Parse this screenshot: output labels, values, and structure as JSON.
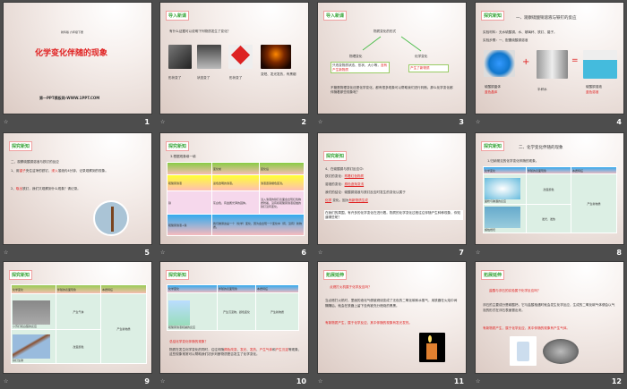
{
  "slides": [
    {
      "number": "1",
      "subtitle": "新科版  六年级下册",
      "title": "化学变化伴随的现象",
      "footer": "第一PPT模板网-WWW.1PPT.COM"
    },
    {
      "number": "2",
      "tag": "导入新课",
      "question": "有什么证据可以说明下列物质发生了变化？",
      "captions": [
        "形状变了",
        "状态变了",
        "形状变了",
        "变短、发光发热，有黑烟"
      ]
    },
    {
      "number": "3",
      "tag": "导入新课",
      "center": "物质变化的形式",
      "left": "物理变化",
      "right": "化学变化",
      "left_box": "只改变物质状态、形状、大小等，",
      "left_box_red": "没有产生新物质",
      "right_box": "产生了新物质",
      "body": "不管是物理变化还是化学变化，都有很多现象可以帮助我们进行判断。那么化学变化都伴随着那些现象呢？"
    },
    {
      "number": "4",
      "tag": "探究新知",
      "heading": "一、观察硫酸铜溶液与铁钉的反应",
      "materials": "实验材料：无水硫酸铜、水、玻璃杯、铁钉、镊子。",
      "steps": "实验步骤：一、配置硫酸铜溶液",
      "captions": [
        [
          "硫酸铜晶体",
          "蓝色晶体"
        ],
        [
          "半杯水",
          ""
        ],
        [
          "硫酸铜溶液",
          "蓝色溶液"
        ]
      ],
      "plus": "+",
      "equals": "="
    },
    {
      "number": "5",
      "tag": "探究新知",
      "line1": "二、观察硫酸铜溶液与铁钉的反应",
      "line2a": "1、用",
      "line2r": "镊子",
      "line2b": "夹住洁净的铁钉，",
      "line2r2": "浸入",
      "line2c": "溶液约4分钟，记录观察到的现象。",
      "line3a": "2、",
      "line3r": "取出",
      "line3b": "铁钉，我们又观察到什么现象？请记录。"
    },
    {
      "number": "6",
      "tag": "探究新知",
      "title": "3.根据现象填一填",
      "headers": [
        "",
        "变化前",
        "变化后"
      ],
      "rows": [
        [
          "硫酸铜溶液",
          "蓝色透明的溶液。",
          "溶液逐渐褪色变浅。"
        ],
        [
          "铁",
          "灰白色，有金属光泽的固体。",
          "浸入溶液的铁钉表面会出现红色物质附着，没有和硫酸铜溶液接触的铁钉没有变化。"
        ],
        [
          "硫酸铜溶液+铁",
          "我们推测这是一个（化学）变化，因为会出现一个变化中（有、没有）新物质。",
          ""
        ]
      ]
    },
    {
      "number": "7",
      "tag": "探究新知",
      "intro": "4、在硫酸铜与铁钉反应中：",
      "l1": "铁钉的变化：",
      "l1r": "附着红色物质",
      "l2": "溶液的变化：",
      "l2r": "颜色逐渐变浅",
      "l3": "我们的结论：硫酸铜溶液与铁钉反应时发生的变化认属于",
      "l4r": "化学",
      "l4": "变化。因为",
      "l4r2": "有新物质生成",
      "box": "在我们的周围，有许多的化学变化在进行着。物质的化学变化过程往往伴随产生种种现象，你知道哪些呢？"
    },
    {
      "number": "8",
      "tag": "探究新知",
      "heading": "二、化学变化伴随的现象",
      "sub": "1.归纳常见的化学变化伴随的现象。",
      "headers": [
        "化学变化",
        "伴随的表面现象",
        "本质特征"
      ],
      "rows": [
        [
          "面粉与碘酒的反应",
          "改变颜色"
        ],
        [
          "蜡烛燃烧",
          "发光、发热"
        ]
      ],
      "essence": "产生新物质"
    },
    {
      "number": "9",
      "tag": "探究新知",
      "headers": [
        "化学变化",
        "伴随的表面现象",
        "本质特征"
      ],
      "rows": [
        [
          "小苏打和白醋的反应",
          "产生气体"
        ],
        [
          "铁钉生锈",
          "改变颜色"
        ]
      ],
      "essence": "产生新物质"
    },
    {
      "number": "10",
      "tag": "探究新知",
      "headers": [
        "化学变化",
        "伴随的表面现象",
        "本质特征"
      ],
      "row": [
        "硫酸铜溶液和碱的反应",
        "产生沉淀物，颜色变化",
        "产生新物质"
      ],
      "question": "总结化学变化伴随的现象？",
      "body_a": "物质在发生化学变化的同时，往往伴随",
      "r1": "颜色改变",
      "s1": "、",
      "r2": "发光",
      "s2": "、",
      "r3": "发热",
      "s3": "、",
      "r4": "产生气体",
      "s4": "和",
      "r5": "产生沉淀",
      "body_b": "等现象，这些现象常常可以帮助我们初步判断物质是否发生了化学变化。"
    },
    {
      "number": "11",
      "tag": "拓展延伸",
      "question": "点燃打火机属于化学反应吗？",
      "body": "当点燃打火机时，里面的液化气便被燃烧变成了无色的二氧化碳和水蒸气，用铁器在火焰中间隔隔后，就会在铁器上留下没有被充分燃烧的黑黑。",
      "answer": "有新物质产生，属于化学反应，其中伴随的现象有发光发热。"
    },
    {
      "number": "12",
      "tag": "拓展延伸",
      "question": "盐酸与浮石的实验属于化学反应吗？",
      "body": "浮石的主要成分是碳酸钙，它与盐酸相遇时就会发生化学反应，生成的二氧化碳气体便会以气泡的形式在浮石表面冒出来。",
      "answer": "有新物质产生，属于化学反应，其中伴随的现象有产生气体。"
    }
  ],
  "transition_icon": "☆",
  "colors": {
    "accent_red": "#e02020",
    "tag_green": "#3aa53a",
    "background": "#4d4d4d"
  }
}
